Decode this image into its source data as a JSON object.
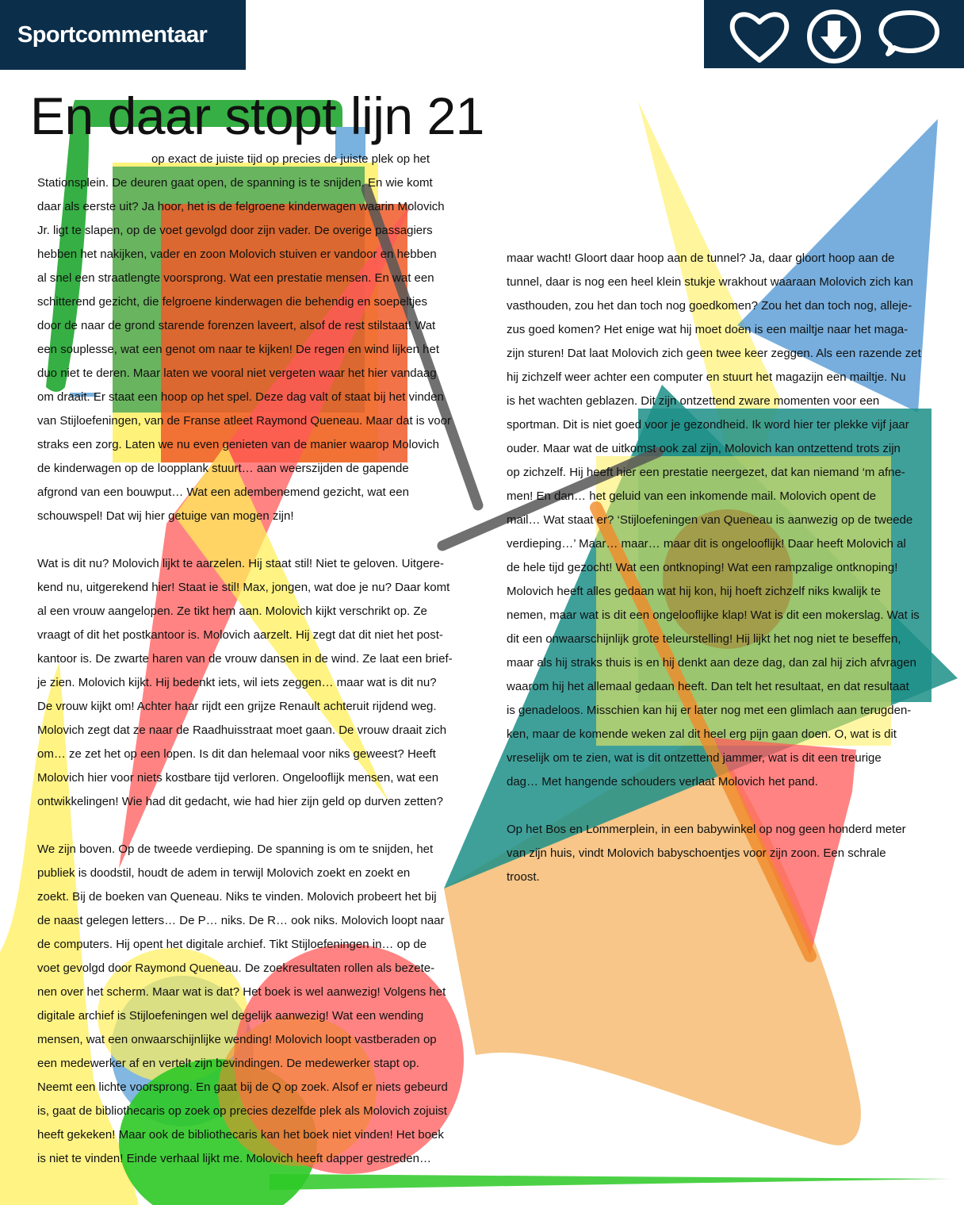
{
  "header": {
    "brand": "Sportcommentaar",
    "actions": [
      {
        "name": "like-button",
        "icon": "heart-icon"
      },
      {
        "name": "download-button",
        "icon": "download-icon"
      },
      {
        "name": "comment-button",
        "icon": "speech-bubble-icon"
      }
    ]
  },
  "colors": {
    "header_bg": "#0b2e4a",
    "shapes": [
      "#2bab3a",
      "#62a5d8",
      "#269d95",
      "#ff5a5a",
      "#ffef5a",
      "#f4a33c",
      "#2dc926",
      "#f5b86a",
      "#575757"
    ]
  },
  "article": {
    "title": "En daar stopt lijn 21",
    "left_column": [
      "op exact de juiste tijd op precies de juiste plek op het\nStationsplein. De deuren gaat open, de spanning is te snijden. En wie komt\ndaar als eerste uit? Ja hoor, het is de felgroene kinderwagen waarin Molovich\nJr. ligt te slapen, op de voet gevolgd door zijn vader. De overige passagiers\nhebben het nakijken, vader en zoon Molovich stuiven er vandoor en hebben\nal snel een straatlengte voorsprong. Wat een prestatie mensen. En wat een\nschitterend gezicht, die felgroene kinderwagen die behendig en soepeltjes\ndoor de naar de grond starende forenzen laveert, alsof de rest stilstaat! Wat\neen souplesse, wat een genot om naar te kijken! De regen en wind lijken het\nduo niet te deren. Maar laten we vooral niet vergeten waar het hier vandaag\nom draait. Er staat een hoop op het spel. Deze dag valt of staat bij het vinden\nvan Stijloefeningen, van de Franse atleet Raymond Queneau. Maar dat is voor\nstraks een zorg. Laten we nu even genieten van de manier waarop Molovich\nde kinderwagen op de loopplank stuurt… aan weerszijden de gapende\nafgrond van een bouwput… Wat een adembenemend gezicht, wat een\nschouwspel! Dat wij hier getuige van mogen zijn!",
      "Wat is dit nu? Molovich lijkt te aarzelen. Hij staat stil! Niet te geloven. Uitgere-\nkend nu, uitgerekend hier! Staat ie stil! Max, jongen, wat doe je nu? Daar komt\nal een vrouw aangelopen. Ze tikt hem aan. Molovich kijkt verschrikt op. Ze\nvraagt of dit het postkantoor is. Molovich aarzelt. Hij zegt dat dit niet het post-\nkantoor is. De zwarte haren van de vrouw dansen in de wind. Ze laat een brief-\nje zien. Molovich kijkt. Hij bedenkt iets, wil iets zeggen… maar wat is dit nu?\nDe vrouw kijkt om! Achter haar rijdt een grijze Renault achteruit rijdend weg.\nMolovich zegt dat ze naar de Raadhuisstraat moet gaan. De vrouw draait zich\nom… ze zet het op een lopen. Is dit dan helemaal voor niks geweest? Heeft\nMolovich hier voor niets kostbare tijd verloren. Ongelooflijk mensen, wat een\nontwikkelingen! Wie had dit gedacht, wie had hier zijn geld op durven zetten?",
      "We zijn boven. Op de tweede verdieping. De spanning is om te snijden, het\npubliek is doodstil, houdt de adem in terwijl Molovich zoekt en zoekt en\nzoekt. Bij de boeken van Queneau. Niks te vinden. Molovich probeert het bij\nde naast gelegen letters… De P… niks. De R… ook niks. Molovich loopt naar\nde computers. Hij opent het digitale archief. Tikt Stijloefeningen in… op de\nvoet gevolgd door Raymond Queneau. De zoekresultaten rollen als bezete-\nnen over het scherm. Maar wat is dat? Het boek is wel aanwezig! Volgens het\ndigitale archief is Stijloefeningen wel degelijk aanwezig! Wat een wending\nmensen, wat een onwaarschijnlijke wending! Molovich loopt vastberaden op\neen medewerker af en vertelt zijn bevindingen. De medewerker stapt op.\nNeemt een lichte voorsprong. En gaat bij de Q op zoek. Alsof er niets gebeurd\nis, gaat de bibliothecaris op zoek op precies dezelfde plek als Molovich zojuist\nheeft gekeken! Maar ook de bibliothecaris kan het boek niet vinden! Het boek\nis niet te vinden! Einde verhaal lijkt me. Molovich heeft dapper gestreden…"
    ],
    "right_column": [
      "maar wacht! Gloort daar hoop aan de tunnel? Ja, daar gloort hoop aan de\ntunnel, daar is nog een heel klein stukje wrakhout waaraan Molovich zich kan\nvasthouden, zou het dan toch nog goedkomen? Zou het dan toch nog, alleje-\nzus goed komen? Het enige wat hij moet doen is een mailtje naar het maga-\nzijn sturen! Dat laat Molovich zich geen twee keer zeggen. Als een razende zet\nhij zichzelf weer achter een computer en stuurt het magazijn een mailtje. Nu\nis het wachten geblazen. Dit zijn ontzettend zware momenten voor een\nsportman. Dit is niet goed voor je gezondheid. Ik word hier ter plekke vijf jaar\nouder. Maar wat de uitkomst ook zal zijn, Molovich kan ontzettend trots zijn\nop zichzelf. Hij heeft hier een prestatie neergezet, dat kan niemand ‘m afne-\nmen! En dan… het geluid van een inkomende mail. Molovich opent de\nmail… Wat staat er? ‘Stijloefeningen van Queneau is aanwezig op de tweede\nverdieping…’ Maar… maar… maar dit is ongelooflijk! Daar heeft Molovich al\nde hele tijd gezocht! Wat een ontknoping! Wat een rampzalige ontknoping!\nMolovich heeft alles gedaan wat hij kon, hij hoeft zichzelf niks kwalijk te\nnemen, maar wat is dit een ongelooflijke klap! Wat is dit een mokerslag. Wat is\ndit een onwaarschijnlijk grote teleurstelling! Hij lijkt het nog niet te beseffen,\nmaar als hij straks thuis is en hij denkt aan deze dag, dan zal hij zich afvragen\nwaarom hij het allemaal gedaan heeft. Dan telt het resultaat, en dat resultaat\nis genadeloos. Misschien kan hij er later nog met een glimlach aan terugden-\nken, maar de komende weken zal dit heel erg pijn gaan doen. O, wat is dit\nvreselijk om te zien, wat is dit ontzettend jammer, wat is dit een treurige\ndag… Met hangende schouders verlaat Molovich het pand.",
      "Op het Bos en Lommerplein, in een babywinkel op nog geen honderd meter\nvan zijn huis, vindt Molovich babyschoentjes voor zijn zoon. Een schrale\ntroost."
    ]
  }
}
